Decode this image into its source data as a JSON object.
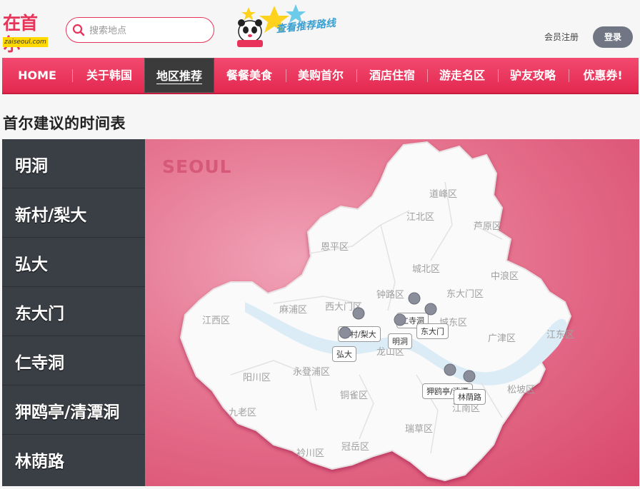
{
  "brand": {
    "logo_cn": "在首尔",
    "logo_en": "zaiseoul.com"
  },
  "search": {
    "placeholder": "搜索地点"
  },
  "promo": {
    "text": "查看推荐路线"
  },
  "account": {
    "register": "会员注册",
    "login": "登录"
  },
  "nav": [
    {
      "label": "HOME"
    },
    {
      "label": "关于韩国"
    },
    {
      "label": "地区推荐",
      "active": true
    },
    {
      "label": "餐餐美食"
    },
    {
      "label": "美购首尔"
    },
    {
      "label": "酒店住宿"
    },
    {
      "label": "游走名区"
    },
    {
      "label": "驴友攻略"
    },
    {
      "label": "优惠券!"
    }
  ],
  "page_title": "首尔建议的时间表",
  "areas": [
    {
      "label": "明洞"
    },
    {
      "label": "新村/梨大"
    },
    {
      "label": "弘大"
    },
    {
      "label": "东大门"
    },
    {
      "label": "仁寺洞"
    },
    {
      "label": "狎鸥亭/清潭洞"
    },
    {
      "label": "林荫路"
    }
  ],
  "map": {
    "watermark": "SEOUL",
    "districts": [
      "道峰区",
      "江北区",
      "芦原区",
      "恩平区",
      "城北区",
      "中浪区",
      "钟路区",
      "东大门区",
      "西大门区",
      "麻浦区",
      "城东区",
      "江西区",
      "广津区",
      "江东区",
      "龙山区",
      "阳川区",
      "永登浦区",
      "松坡区",
      "九老区",
      "铜雀区",
      "江南区",
      "瑞草区",
      "衿川区",
      "冠岳区"
    ],
    "pins": [
      {
        "label": "新村/梨大"
      },
      {
        "label": "弘大"
      },
      {
        "label": "明洞"
      },
      {
        "label": "仁寺洞"
      },
      {
        "label": "东大门"
      },
      {
        "label": "狎鸥亭/清潭"
      },
      {
        "label": "林荫路"
      }
    ]
  },
  "colors": {
    "accent": "#e8345a",
    "nav_bg": "#eb3a62",
    "sidebar_bg": "#3a3e45",
    "active_nav": "#3b3b3b"
  }
}
